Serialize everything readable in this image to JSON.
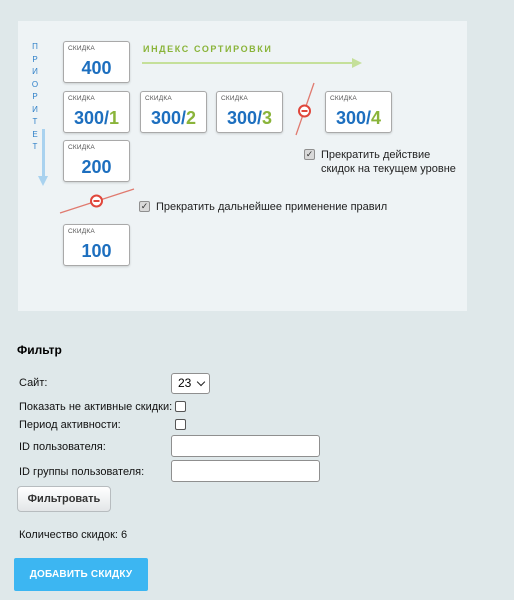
{
  "diagram": {
    "priority_letters": [
      "П",
      "Р",
      "И",
      "О",
      "Р",
      "И",
      "Т",
      "Е",
      "Т"
    ],
    "sort_index_label": "ИНДЕКС СОРТИРОВКИ",
    "cards": [
      {
        "label": "СКИДКА",
        "value": "400",
        "index": ""
      },
      {
        "label": "СКИДКА",
        "value": "300",
        "index": "1"
      },
      {
        "label": "СКИДКА",
        "value": "300",
        "index": "2"
      },
      {
        "label": "СКИДКА",
        "value": "300",
        "index": "3"
      },
      {
        "label": "СКИДКА",
        "value": "300",
        "index": "4"
      },
      {
        "label": "СКИДКА",
        "value": "200",
        "index": ""
      },
      {
        "label": "СКИДКА",
        "value": "100",
        "index": ""
      }
    ],
    "stop_level_text": "Прекратить действие скидок на текущем уровне",
    "stop_all_text": "Прекратить дальнейшее применение правил",
    "colors": {
      "blue": "#1d6fbf",
      "green": "#8ab43a",
      "stop": "#e0463b"
    }
  },
  "filter": {
    "title": "Фильтр",
    "site_label": "Сайт:",
    "site_value": "23",
    "show_inactive_label": "Показать не активные скидки:",
    "active_period_label": "Период активности:",
    "user_id_label": "ID пользователя:",
    "group_id_label": "ID группы пользователя:",
    "user_id_value": "",
    "group_id_value": "",
    "filter_button": "Фильтровать"
  },
  "count_text": "Количество скидок: 6",
  "add_button": "ДОБАВИТЬ СКИДКУ"
}
